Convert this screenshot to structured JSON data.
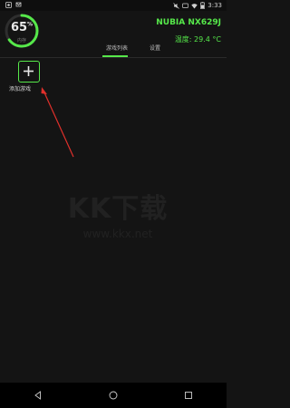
{
  "status_bar": {
    "time": "3:33",
    "battery_level": "partial"
  },
  "gauge": {
    "percent": "65",
    "percent_unit": "%",
    "sub_label": "内存",
    "fill_fraction": 0.65,
    "accent": "#56e84a"
  },
  "device": {
    "name": "NUBIA NX629J",
    "temperature_label": "温度: 29.4 °C"
  },
  "tabs": [
    {
      "label": "游戏列表",
      "active": true
    },
    {
      "label": "设置",
      "active": false
    }
  ],
  "main": {
    "add_game_label": "添加游戏"
  },
  "watermark": {
    "brand": "KK下载",
    "url": "www.kkx.net"
  },
  "colors": {
    "accent": "#56e84a",
    "background": "#141414",
    "arrow": "#e0302b"
  }
}
